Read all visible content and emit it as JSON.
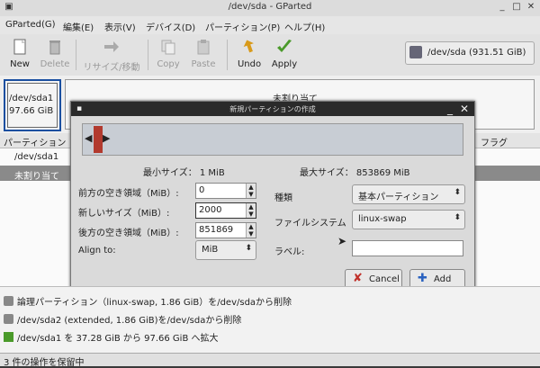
{
  "window": {
    "title": "/dev/sda - GParted"
  },
  "menu": [
    "GParted(G)",
    "編集(E)",
    "表示(V)",
    "デバイス(D)",
    "パーティション(P)",
    "ヘルプ(H)"
  ],
  "toolbar": {
    "new": "New",
    "delete": "Delete",
    "resize": "リサイズ/移動",
    "copy": "Copy",
    "paste": "Paste",
    "undo": "Undo",
    "apply": "Apply"
  },
  "device_selector": {
    "label": "/dev/sda   (931.51 GiB)"
  },
  "graph": {
    "part_name": "/dev/sda1",
    "part_size": "97.66 GiB",
    "unallocated": "未割り当て"
  },
  "list": {
    "col_partition": "パーティション",
    "col_flags": "フラグ",
    "rows": [
      "/dev/sda1",
      "未割り当て"
    ]
  },
  "dialog": {
    "title": "新規パーティションの作成",
    "min_size": "最小サイズ：  1  MiB",
    "max_size": "最大サイズ：  853869  MiB",
    "free_before_label": "前方の空き領域（MiB）:",
    "free_before_value": "0",
    "new_size_label": "新しいサイズ（MiB）:",
    "new_size_value": "2000",
    "free_after_label": "後方の空き領域（MiB）:",
    "free_after_value": "851869",
    "align_label": "Align to:",
    "align_value": "MiB",
    "type_label": "種類",
    "type_value": "基本パーティション",
    "fs_label": "ファイルシステム",
    "fs_value": "linux-swap",
    "label_label": "ラベル:",
    "label_value": "",
    "cancel": "Cancel",
    "add": "Add"
  },
  "operations": [
    "論理パーティション（linux-swap, 1.86 GiB）を/dev/sdaから削除",
    "/dev/sda2 (extended, 1.86 GiB)を/dev/sdaから削除",
    "/dev/sda1 を 37.28 GiB から 97.66 GiB へ拡大"
  ],
  "status": "3 件の操作を保留中",
  "colors": {
    "selection_border": "#1a4fa0",
    "partition_block": "#b23a2e",
    "apply_check": "#4a9a2a",
    "undo_arrow": "#d89a1a"
  }
}
